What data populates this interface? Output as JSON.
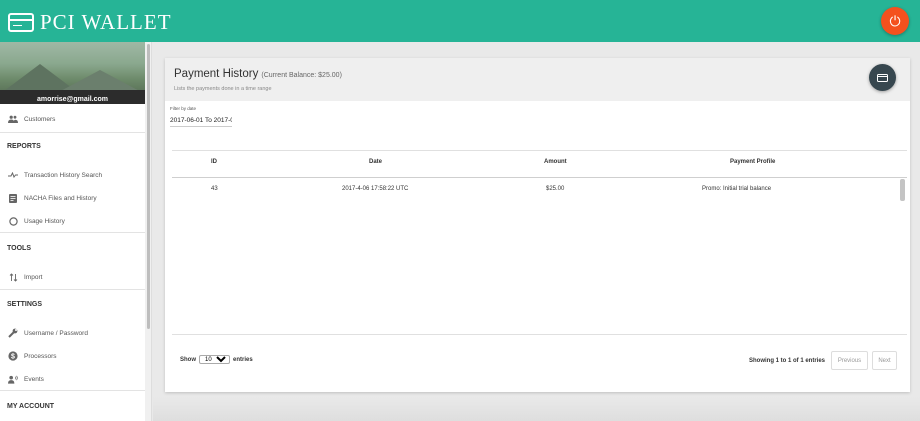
{
  "app": {
    "title": "PCI WALLET"
  },
  "colors": {
    "topbar": "#26b496",
    "logout": "#f4511e",
    "fab": "#37474f"
  },
  "user": {
    "email": "amorrise@gmail.com"
  },
  "sidebar": {
    "customers": "Customers",
    "reports": {
      "heading": "REPORTS",
      "items": [
        "Transaction History Search",
        "NACHA Files and History",
        "Usage History"
      ]
    },
    "tools": {
      "heading": "TOOLS",
      "items": [
        "Import"
      ]
    },
    "settings": {
      "heading": "SETTINGS",
      "items": [
        "Username / Password",
        "Processors",
        "Events"
      ]
    },
    "account": {
      "heading": "MY ACCOUNT"
    }
  },
  "page": {
    "title": "Payment History",
    "balance": "(Current Balance: $25.00)",
    "subtitle": "Lists the payments done in a time range",
    "filter_label": "Filter by date",
    "filter_value": "2017-06-01 To 2017-0"
  },
  "table": {
    "columns": [
      "ID",
      "Date",
      "Amount",
      "Payment Profile"
    ],
    "rows": [
      [
        "43",
        "2017-4-06 17:58:22 UTC",
        "$25.00",
        "Promo: Initial trial balance"
      ]
    ]
  },
  "footer": {
    "show_label": "Show",
    "entries_label": "entries",
    "page_size": "10",
    "showing": "Showing 1 to 1 of 1 entries",
    "previous": "Previous",
    "next": "Next"
  }
}
